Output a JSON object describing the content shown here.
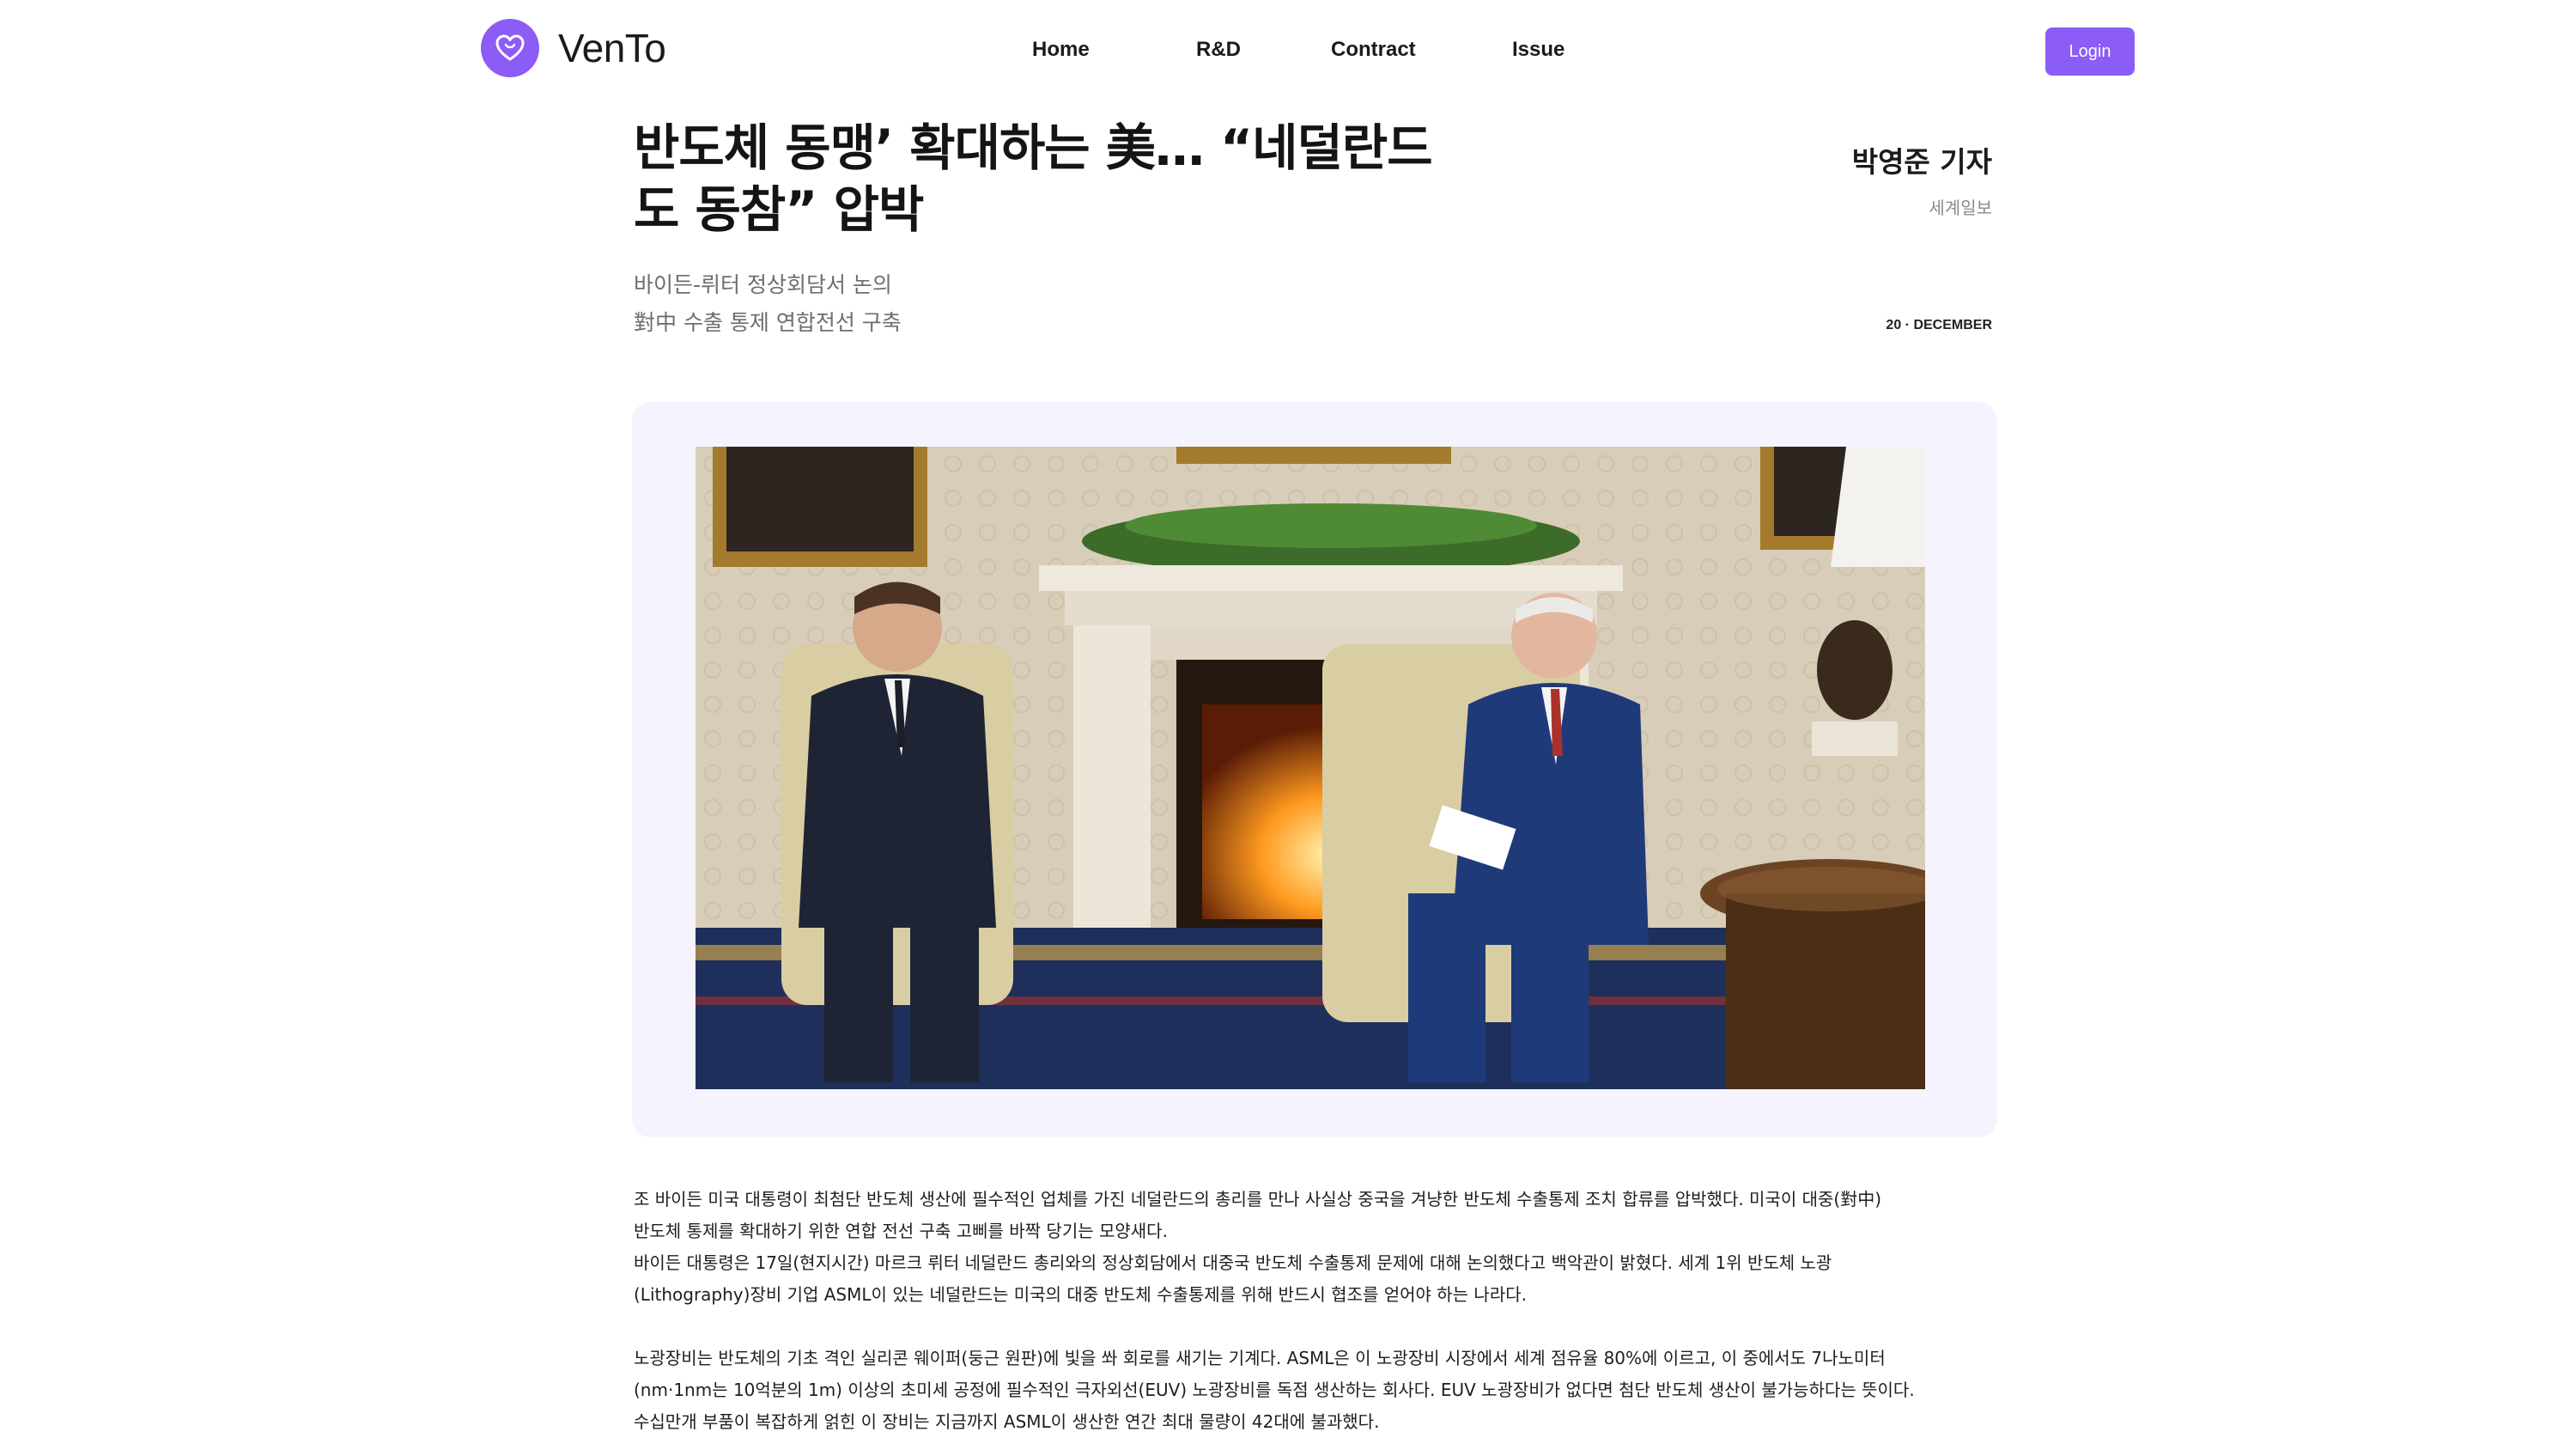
{
  "brand": {
    "name": "VenTo",
    "logo_icon": "heart-icon",
    "accent_color": "#8b5cf6"
  },
  "nav": {
    "items": [
      "Home",
      "R&D",
      "Contract",
      "Issue"
    ],
    "login_label": "Login"
  },
  "article": {
    "title_line1": "반도체 동맹’ 확대하는 美… “네덜란드",
    "title_line2": "도 동참” 압박",
    "subtitle_line1": "바이든-뤼터 정상회담서 논의",
    "subtitle_line2": "對中 수출 통제 연합전선 구축",
    "reporter": "박영준 기자",
    "press": "세계일보",
    "date": "20 · DECEMBER",
    "photo_alt": "photo",
    "paragraphs": [
      "조 바이든 미국 대통령이 최첨단 반도체 생산에 필수적인 업체를 가진 네덜란드의 총리를 만나 사실상 중국을 겨냥한 반도체 수출통제 조치 합류를 압박했다. 미국이 대중(對中)",
      "반도체 통제를 확대하기 위한 연합 전선 구축 고삐를 바짝 당기는 모양새다.",
      "바이든 대통령은 17일(현지시간) 마르크 뤼터 네덜란드 총리와의 정상회담에서 대중국 반도체 수출통제 문제에 대해 논의했다고 백악관이 밝혔다. 세계 1위 반도체 노광",
      "(Lithography)장비 기업 ASML이 있는 네덜란드는 미국의 대중 반도체 수출통제를 위해 반드시 협조를 얻어야 하는 나라다.",
      "노광장비는 반도체의 기초 격인 실리콘 웨이퍼(둥근 원판)에 빛을 쏴 회로를 새기는 기계다. ASML은 이 노광장비 시장에서 세계 점유율 80%에 이르고, 이 중에서도 7나노미터",
      "(nm·1nm는 10억분의 1m) 이상의 초미세 공정에 필수적인 극자외선(EUV) 노광장비를 독점 생산하는 회사다. EUV 노광장비가 없다면 첨단 반도체 생산이 불가능하다는 뜻이다.",
      "수십만개 부품이 복잡하게 얽힌 이 장비는 지금까지 ASML이 생산한 연간 최대 물량이 42대에 불과했다."
    ]
  }
}
